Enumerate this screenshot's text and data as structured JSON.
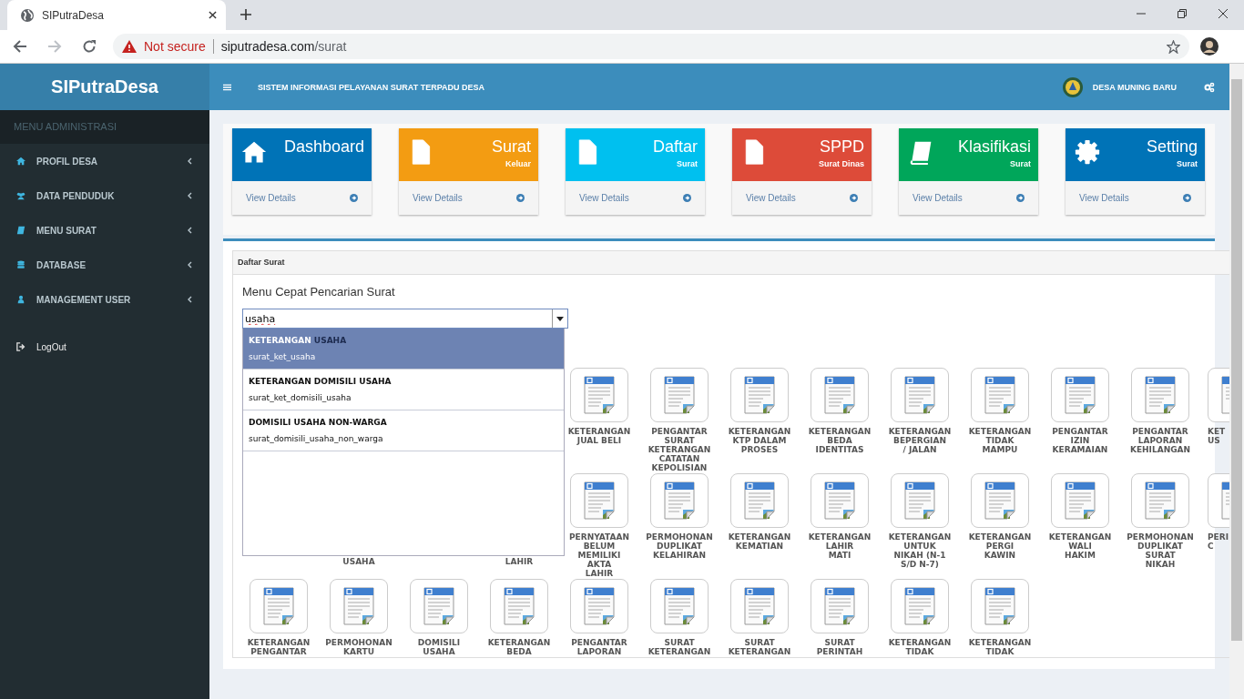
{
  "browser": {
    "tab_title": "SIPutraDesa",
    "security": "Not secure",
    "url_host": "siputradesa.com",
    "url_path": "/surat"
  },
  "app": {
    "logo": "SIPutraDesa",
    "header_title": "SISTEM INFORMASI PELAYANAN SURAT TERPADU DESA",
    "village": "DESA MUNING BARU"
  },
  "sidebar": {
    "heading": "MENU ADMINISTRASI",
    "items": [
      {
        "label": "PROFIL DESA",
        "kind": "home"
      },
      {
        "label": "DATA PENDUDUK",
        "kind": "users"
      },
      {
        "label": "MENU SURAT",
        "kind": "book"
      },
      {
        "label": "DATABASE",
        "kind": "database"
      },
      {
        "label": "MANAGEMENT USER",
        "kind": "user"
      }
    ],
    "logout": "LogOut"
  },
  "info_boxes": [
    {
      "title": "Dashboard",
      "kind": "home",
      "color": "#0073b7",
      "link": "View Details"
    },
    {
      "title": "Surat",
      "subtitle": "Keluar",
      "kind": "file",
      "color": "#f39c12",
      "link": "View Details"
    },
    {
      "title": "Daftar",
      "subtitle": "Surat",
      "kind": "file",
      "color": "#00c0ef",
      "link": "View Details"
    },
    {
      "title": "SPPD",
      "subtitle": "Surat Dinas",
      "kind": "file",
      "color": "#dd4b39",
      "link": "View Details"
    },
    {
      "title": "Klasifikasi",
      "subtitle": "Surat",
      "kind": "book",
      "color": "#00a65a",
      "link": "View Details"
    },
    {
      "title": "Setting",
      "subtitle": "Surat",
      "kind": "gear",
      "color": "#0073b7",
      "link": "View Details"
    }
  ],
  "panel": {
    "title": "Daftar Surat"
  },
  "search": {
    "label": "Menu Cepat Pencarian Surat",
    "value": "usaha",
    "results": [
      {
        "title_parts": [
          {
            "text": "KETERANGAN ",
            "match": false
          },
          {
            "text": "USAHA",
            "match": true
          }
        ],
        "code": "surat_ket_usaha",
        "selected": true
      },
      {
        "title_parts": [
          {
            "text": "KETERANGAN DOMISILI USAHA",
            "match": false
          }
        ],
        "code": "surat_ket_domisili_usaha",
        "selected": false
      },
      {
        "title_parts": [
          {
            "text": "DOMISILI USAHA NON-WARGA",
            "match": false
          }
        ],
        "code": "surat_domisili_usaha_non_warga",
        "selected": false
      }
    ]
  },
  "grid": {
    "rows": [
      [
        null,
        null,
        null,
        null,
        {
          "kind": "tile",
          "lines": [
            "KETERANGAN",
            "JUAL BELI"
          ]
        },
        {
          "kind": "tile",
          "lines": [
            "PENGANTAR",
            "SURAT",
            "KETERANGAN",
            "CATATAN",
            "KEPOLISIAN"
          ]
        },
        {
          "kind": "tile",
          "lines": [
            "KETERANGAN",
            "KTP DALAM",
            "PROSES"
          ]
        },
        {
          "kind": "tile",
          "lines": [
            "KETERANGAN",
            "BEDA",
            "IDENTITAS"
          ]
        },
        {
          "kind": "tile",
          "lines": [
            "KETERANGAN",
            "BEPERGIAN",
            "/ JALAN"
          ]
        },
        {
          "kind": "tile",
          "lines": [
            "KETERANGAN",
            "TIDAK",
            "MAMPU"
          ]
        },
        {
          "kind": "tile",
          "lines": [
            "PENGANTAR",
            "IZIN",
            "KERAMAIAN"
          ]
        },
        {
          "kind": "tile",
          "lines": [
            "PENGANTAR",
            "LAPORAN",
            "KEHILANGAN"
          ]
        },
        {
          "kind": "cut",
          "lines": [
            "KET",
            "US"
          ]
        }
      ],
      [
        null,
        {
          "kind": "covered",
          "lines": [
            "USAHA"
          ]
        },
        null,
        {
          "kind": "covered",
          "lines": [
            "LAHIR"
          ]
        },
        {
          "kind": "tile",
          "lines": [
            "PERNYATAAN",
            "BELUM",
            "MEMILIKI",
            "AKTA",
            "LAHIR"
          ]
        },
        {
          "kind": "tile",
          "lines": [
            "PERMOHONAN",
            "DUPLIKAT",
            "KELAHIRAN"
          ]
        },
        {
          "kind": "tile",
          "lines": [
            "KETERANGAN",
            "KEMATIAN"
          ]
        },
        {
          "kind": "tile",
          "lines": [
            "KETERANGAN",
            "LAHIR",
            "MATI"
          ]
        },
        {
          "kind": "tile",
          "lines": [
            "KETERANGAN",
            "UNTUK",
            "NIKAH (N-1",
            "S/D N-7)"
          ]
        },
        {
          "kind": "tile",
          "lines": [
            "KETERANGAN",
            "PERGI",
            "KAWIN"
          ]
        },
        {
          "kind": "tile",
          "lines": [
            "KETERANGAN",
            "WALI",
            "HAKIM"
          ]
        },
        {
          "kind": "tile",
          "lines": [
            "PERMOHONAN",
            "DUPLIKAT",
            "SURAT",
            "NIKAH"
          ]
        },
        {
          "kind": "cut",
          "lines": [
            "PERI",
            "C"
          ]
        }
      ],
      [
        {
          "kind": "tile",
          "lines": [
            "KETERANGAN",
            "PENGANTAR"
          ]
        },
        {
          "kind": "tile",
          "lines": [
            "PERMOHONAN",
            "KARTU"
          ]
        },
        {
          "kind": "tile",
          "lines": [
            "DOMISILI",
            "USAHA"
          ]
        },
        {
          "kind": "tile",
          "lines": [
            "KETERANGAN",
            "BEDA"
          ]
        },
        {
          "kind": "tile",
          "lines": [
            "PENGANTAR",
            "LAPORAN"
          ]
        },
        {
          "kind": "tile",
          "lines": [
            "SURAT",
            "KETERANGAN"
          ]
        },
        {
          "kind": "tile",
          "lines": [
            "SURAT",
            "KETERANGAN"
          ]
        },
        {
          "kind": "tile",
          "lines": [
            "SURAT",
            "PERINTAH"
          ]
        },
        {
          "kind": "tile",
          "lines": [
            "KETERANGAN",
            "TIDAK"
          ]
        },
        {
          "kind": "tile",
          "lines": [
            "KETERANGAN",
            "TIDAK"
          ]
        }
      ]
    ]
  }
}
